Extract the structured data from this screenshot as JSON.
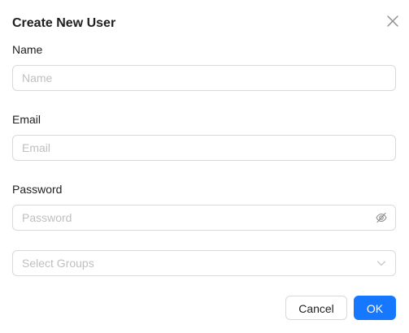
{
  "dialog": {
    "title": "Create New User",
    "close_icon": "close-icon"
  },
  "fields": {
    "name": {
      "label": "Name",
      "placeholder": "Name",
      "value": ""
    },
    "email": {
      "label": "Email",
      "placeholder": "Email",
      "value": ""
    },
    "password": {
      "label": "Password",
      "placeholder": "Password",
      "value": "",
      "toggle_icon": "eye-invisible-icon"
    },
    "groups": {
      "placeholder": "Select Groups",
      "arrow_icon": "chevron-down-icon"
    }
  },
  "footer": {
    "cancel_label": "Cancel",
    "ok_label": "OK"
  },
  "colors": {
    "primary": "#1677ff",
    "border": "#d9d9d9",
    "placeholder": "#bfbfbf",
    "text": "#1f1f1f"
  }
}
